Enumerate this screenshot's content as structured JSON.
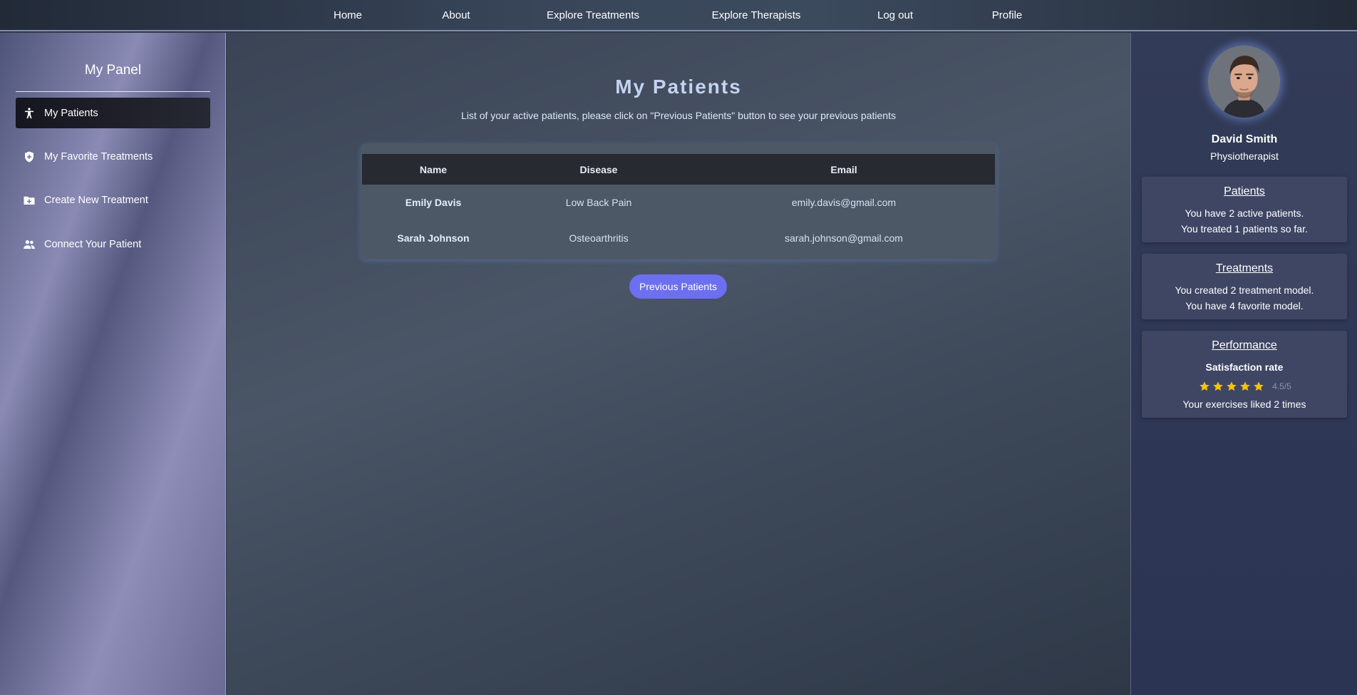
{
  "nav": {
    "items": [
      {
        "label": "Home"
      },
      {
        "label": "About"
      },
      {
        "label": "Explore Treatments"
      },
      {
        "label": "Explore Therapists"
      },
      {
        "label": "Log out"
      },
      {
        "label": "Profile"
      }
    ]
  },
  "sidebar": {
    "title": "My Panel",
    "items": [
      {
        "label": "My Patients",
        "icon": "person-accessibility-icon",
        "active": true
      },
      {
        "label": "My Favorite Treatments",
        "icon": "shield-plus-icon"
      },
      {
        "label": "Create New Treatment",
        "icon": "folder-plus-icon"
      },
      {
        "label": "Connect Your Patient",
        "icon": "users-icon"
      }
    ]
  },
  "main": {
    "title": "My Patients",
    "subtitle": "List of your active patients, please click on \"Previous Patients\" button to see your previous patients",
    "table": {
      "headers": [
        "Name",
        "Disease",
        "Email"
      ],
      "rows": [
        [
          "Emily Davis",
          "Low Back Pain",
          "emily.davis@gmail.com"
        ],
        [
          "Sarah Johnson",
          "Osteoarthritis",
          "sarah.johnson@gmail.com"
        ]
      ]
    },
    "previous_button": "Previous Patients"
  },
  "profile": {
    "name": "David Smith",
    "role": "Physiotherapist",
    "patients": {
      "title": "Patients",
      "line1": "You have 2 active patients.",
      "line2": "You treated 1 patients so far."
    },
    "treatments": {
      "title": "Treatments",
      "line1": "You created 2 treatment model.",
      "line2": "You have 4 favorite model."
    },
    "performance": {
      "title": "Performance",
      "subtitle": "Satisfaction rate",
      "rating_text": "4.5/5",
      "stars": 5,
      "likes": "Your exercises liked 2 times"
    }
  },
  "colors": {
    "accent_button": "#6c6ff0",
    "star": "#f4c20d",
    "title_text": "#c5d3f1"
  }
}
